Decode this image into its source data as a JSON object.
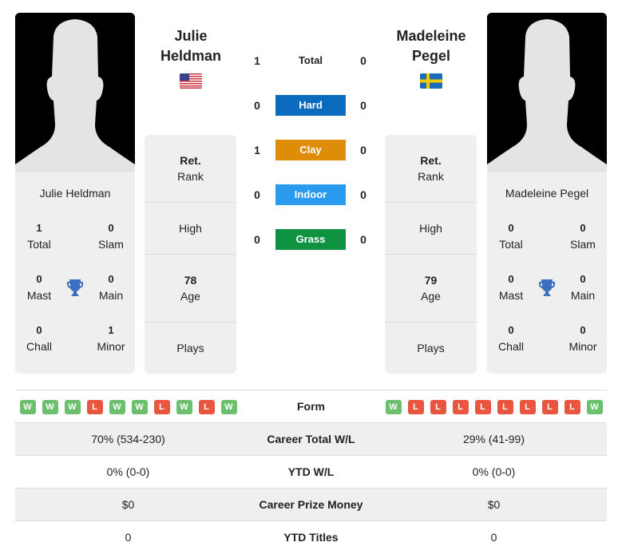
{
  "colors": {
    "hard": "#0a6bbf",
    "clay": "#df8c08",
    "indoor": "#2b9bf0",
    "grass": "#0f9341",
    "win": "#6cbf6c",
    "loss": "#e8563f",
    "trophy": "#3b6fbf"
  },
  "players": [
    {
      "name_line1": "Julie",
      "name_line2": "Heldman",
      "full_name": "Julie Heldman",
      "flag": "us-flag",
      "titles": {
        "total": "1",
        "slam": "0",
        "mast": "0",
        "main": "0",
        "chall": "0",
        "minor": "1"
      },
      "info": {
        "rank_label_bold": "Ret.",
        "rank_label": "Rank",
        "high_label": "High",
        "age_value": "78",
        "age_label": "Age",
        "plays_label": "Plays"
      },
      "form": [
        "W",
        "W",
        "W",
        "L",
        "W",
        "W",
        "L",
        "W",
        "L",
        "W"
      ],
      "career_wl": "70% (534-230)",
      "ytd_wl": "0% (0-0)",
      "prize": "$0",
      "ytd_titles": "0"
    },
    {
      "name_line1": "Madeleine",
      "name_line2": "Pegel",
      "full_name": "Madeleine Pegel",
      "flag": "se-flag",
      "titles": {
        "total": "0",
        "slam": "0",
        "mast": "0",
        "main": "0",
        "chall": "0",
        "minor": "0"
      },
      "info": {
        "rank_label_bold": "Ret.",
        "rank_label": "Rank",
        "high_label": "High",
        "age_value": "79",
        "age_label": "Age",
        "plays_label": "Plays"
      },
      "form": [
        "W",
        "L",
        "L",
        "L",
        "L",
        "L",
        "L",
        "L",
        "L",
        "W"
      ],
      "career_wl": "29% (41-99)",
      "ytd_wl": "0% (0-0)",
      "prize": "$0",
      "ytd_titles": "0"
    }
  ],
  "labels": {
    "total": "Total",
    "slam": "Slam",
    "mast": "Mast",
    "main": "Main",
    "chall": "Chall",
    "minor": "Minor"
  },
  "h2h": [
    {
      "surface": "Total",
      "left": "1",
      "right": "0"
    },
    {
      "surface": "Hard",
      "left": "0",
      "right": "0"
    },
    {
      "surface": "Clay",
      "left": "1",
      "right": "0"
    },
    {
      "surface": "Indoor",
      "left": "0",
      "right": "0"
    },
    {
      "surface": "Grass",
      "left": "0",
      "right": "0"
    }
  ],
  "stats_labels": {
    "form": "Form",
    "career_wl": "Career Total W/L",
    "ytd_wl": "YTD W/L",
    "prize": "Career Prize Money",
    "ytd_titles": "YTD Titles"
  }
}
